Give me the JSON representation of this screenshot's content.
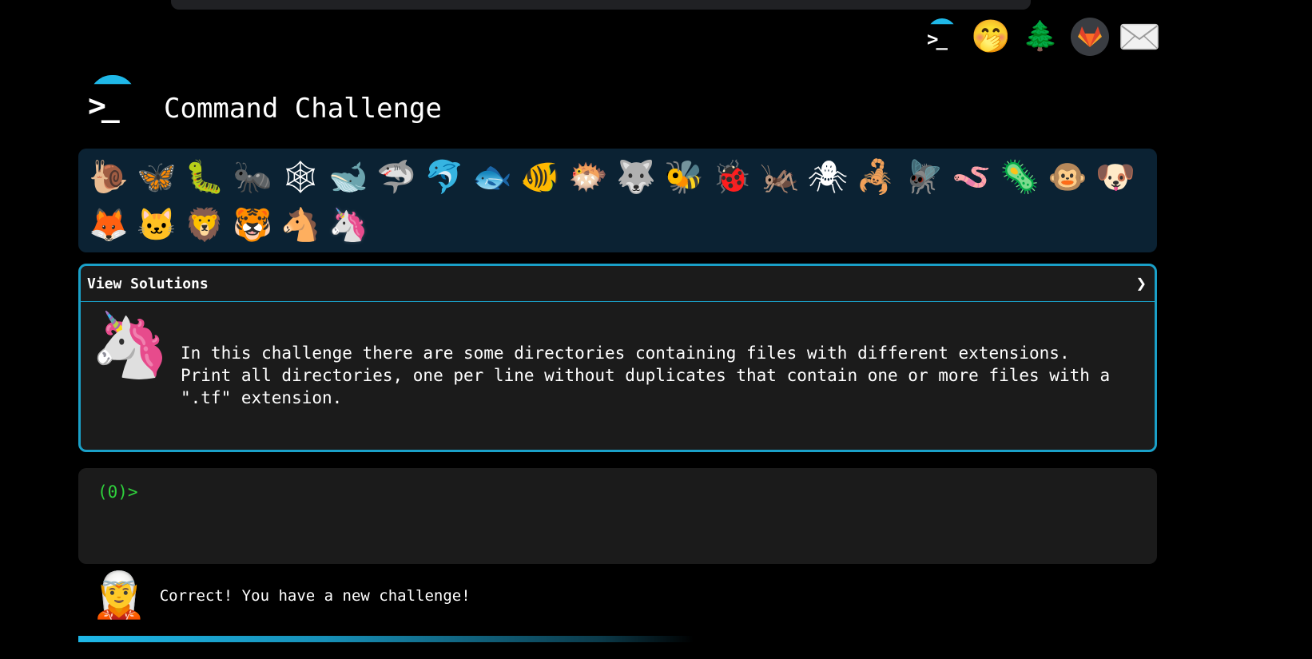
{
  "app": {
    "title": "Command Challenge",
    "logo_text": ">_"
  },
  "header_icons": [
    {
      "name": "command-challenge-home-icon"
    },
    {
      "name": "shushing-face-icon",
      "glyph": "🤭"
    },
    {
      "name": "tree-icon",
      "glyph": "🌲"
    },
    {
      "name": "gitlab-icon"
    },
    {
      "name": "mail-icon"
    }
  ],
  "animals": [
    {
      "name": "snail-icon",
      "glyph": "🐌"
    },
    {
      "name": "butterfly-icon",
      "glyph": "🦋"
    },
    {
      "name": "caterpillar-icon",
      "glyph": "🐛"
    },
    {
      "name": "ant-icon",
      "glyph": "🐜"
    },
    {
      "name": "spider-web-icon",
      "glyph": "🕸"
    },
    {
      "name": "whale-icon",
      "glyph": "🐋"
    },
    {
      "name": "shark-icon",
      "glyph": "🦈"
    },
    {
      "name": "dolphin-icon",
      "glyph": "🐬"
    },
    {
      "name": "fish-icon",
      "glyph": "🐟"
    },
    {
      "name": "tropical-fish-icon",
      "glyph": "🐠"
    },
    {
      "name": "blowfish-icon",
      "glyph": "🐡"
    },
    {
      "name": "wolf-icon",
      "glyph": "🐺"
    },
    {
      "name": "bee-icon",
      "glyph": "🐝"
    },
    {
      "name": "ladybug-icon",
      "glyph": "🐞"
    },
    {
      "name": "cricket-icon",
      "glyph": "🦗"
    },
    {
      "name": "spider-icon",
      "glyph": "🕷"
    },
    {
      "name": "scorpion-icon",
      "glyph": "🦂"
    },
    {
      "name": "fly-icon",
      "glyph": "🪰"
    },
    {
      "name": "worm-icon",
      "glyph": "🪱"
    },
    {
      "name": "microbe-icon",
      "glyph": "🦠"
    },
    {
      "name": "monkey-icon",
      "glyph": "🐵"
    },
    {
      "name": "dog-icon",
      "glyph": "🐶"
    },
    {
      "name": "fox-icon",
      "glyph": "🦊"
    },
    {
      "name": "cat-icon",
      "glyph": "🐱"
    },
    {
      "name": "lion-icon",
      "glyph": "🦁"
    },
    {
      "name": "tiger-icon",
      "glyph": "🐯"
    },
    {
      "name": "horse-icon",
      "glyph": "🐴"
    },
    {
      "name": "unicorn-icon",
      "glyph": "🦄",
      "current": true
    }
  ],
  "challenge": {
    "solutions_label": "View Solutions",
    "chevron": "❯",
    "avatar": "🦄",
    "description": "In this challenge there are some directories containing files with different extensions.\nPrint all directories, one per line without duplicates that contain one or more files with a\n\".tf\" extension."
  },
  "terminal": {
    "prompt": "(0)>"
  },
  "feedback": {
    "avatar": "🧝",
    "message": "Correct! You have a new challenge!"
  },
  "progress": {
    "fraction": 0.57
  }
}
